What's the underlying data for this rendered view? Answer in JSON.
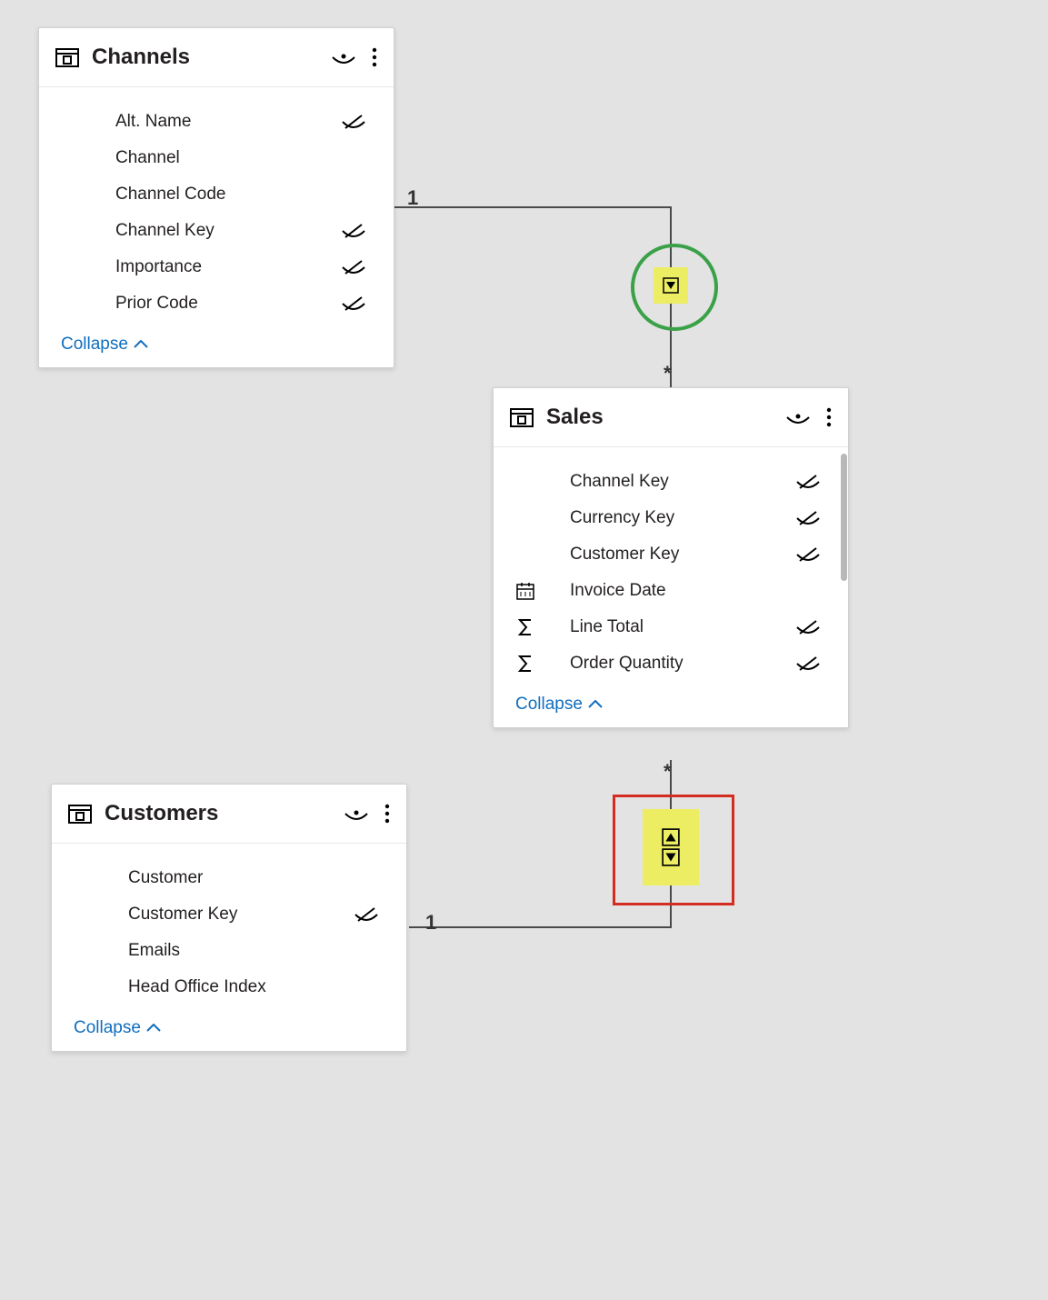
{
  "tables": {
    "channels": {
      "title": "Channels",
      "collapse": "Collapse",
      "fields": [
        {
          "name": "Alt. Name",
          "hidden": true,
          "type": "none"
        },
        {
          "name": "Channel",
          "hidden": false,
          "type": "none"
        },
        {
          "name": "Channel Code",
          "hidden": false,
          "type": "none"
        },
        {
          "name": "Channel Key",
          "hidden": true,
          "type": "none"
        },
        {
          "name": "Importance",
          "hidden": true,
          "type": "none"
        },
        {
          "name": "Prior Code",
          "hidden": true,
          "type": "none"
        }
      ]
    },
    "sales": {
      "title": "Sales",
      "collapse": "Collapse",
      "fields": [
        {
          "name": "Channel Key",
          "hidden": true,
          "type": "none"
        },
        {
          "name": "Currency Key",
          "hidden": true,
          "type": "none"
        },
        {
          "name": "Customer Key",
          "hidden": true,
          "type": "none"
        },
        {
          "name": "Invoice Date",
          "hidden": false,
          "type": "date"
        },
        {
          "name": "Line Total",
          "hidden": true,
          "type": "sum"
        },
        {
          "name": "Order Quantity",
          "hidden": true,
          "type": "sum"
        }
      ]
    },
    "customers": {
      "title": "Customers",
      "collapse": "Collapse",
      "fields": [
        {
          "name": "Customer",
          "hidden": false,
          "type": "none"
        },
        {
          "name": "Customer Key",
          "hidden": true,
          "type": "none"
        },
        {
          "name": "Emails",
          "hidden": false,
          "type": "none"
        },
        {
          "name": "Head Office Index",
          "hidden": false,
          "type": "none"
        }
      ]
    }
  },
  "relationships": {
    "channels_to_sales": {
      "from_card": "1",
      "to_card": "*",
      "direction": "single",
      "highlight": "green-circle"
    },
    "customers_to_sales": {
      "from_card": "1",
      "to_card": "*",
      "direction": "both",
      "highlight": "red-box"
    }
  }
}
